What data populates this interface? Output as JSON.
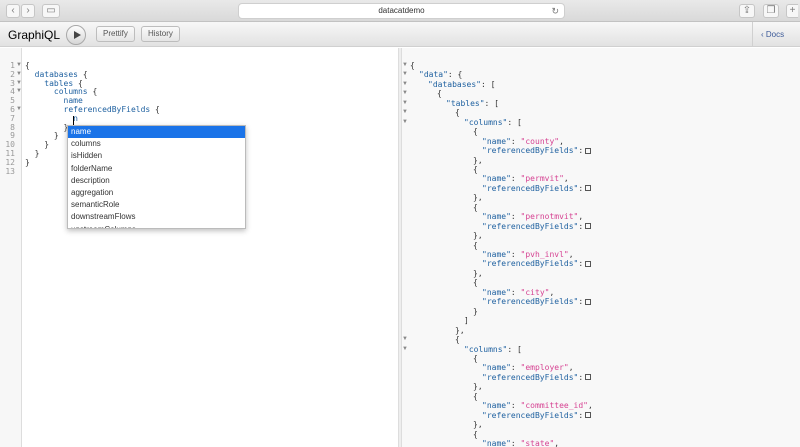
{
  "browser": {
    "url": "datacatdemo",
    "back_glyph": "‹",
    "forward_glyph": "›",
    "sidebar_glyph": "▭",
    "reload_glyph": "↻",
    "share_glyph": "⇪",
    "tabs_glyph": "❐",
    "newtab_glyph": "+"
  },
  "toolbar": {
    "logo": "GraphiQL",
    "prettify_label": "Prettify",
    "history_label": "History",
    "docs_label": "Docs"
  },
  "editor": {
    "lines": [
      "{",
      "  databases {",
      "    tables {",
      "      columns {",
      "        name",
      "        referencedByFields {",
      "          n",
      "        }",
      "      }",
      "    }",
      "  }",
      "}",
      ""
    ],
    "line_numbers": [
      "1",
      "2",
      "3",
      "4",
      "5",
      "6",
      "7",
      "8",
      "9",
      "10",
      "11",
      "12",
      "13"
    ]
  },
  "autocomplete": {
    "items": [
      "name",
      "columns",
      "isHidden",
      "folderName",
      "description",
      "aggregation",
      "semanticRole",
      "downstreamFlows",
      "upstreamColumns"
    ],
    "selected_index": 0
  },
  "result": {
    "lines": [
      {
        "indent": 0,
        "text": "{"
      },
      {
        "indent": 1,
        "key": "\"data\"",
        "text": ": {"
      },
      {
        "indent": 2,
        "key": "\"databases\"",
        "text": ": ["
      },
      {
        "indent": 3,
        "text": "{"
      },
      {
        "indent": 4,
        "key": "\"tables\"",
        "text": ": ["
      },
      {
        "indent": 5,
        "text": "{"
      },
      {
        "indent": 6,
        "key": "\"columns\"",
        "text": ": ["
      },
      {
        "indent": 7,
        "text": "{"
      },
      {
        "indent": 8,
        "key": "\"name\"",
        "str": "\"county\"",
        "text": ","
      },
      {
        "indent": 8,
        "key": "\"referencedByFields\"",
        "text": ":",
        "box": true
      },
      {
        "indent": 7,
        "text": "},"
      },
      {
        "indent": 7,
        "text": "{"
      },
      {
        "indent": 8,
        "key": "\"name\"",
        "str": "\"permvit\"",
        "text": ","
      },
      {
        "indent": 8,
        "key": "\"referencedByFields\"",
        "text": ":",
        "box": true
      },
      {
        "indent": 7,
        "text": "},"
      },
      {
        "indent": 7,
        "text": "{"
      },
      {
        "indent": 8,
        "key": "\"name\"",
        "str": "\"pernotmvit\"",
        "text": ","
      },
      {
        "indent": 8,
        "key": "\"referencedByFields\"",
        "text": ":",
        "box": true
      },
      {
        "indent": 7,
        "text": "},"
      },
      {
        "indent": 7,
        "text": "{"
      },
      {
        "indent": 8,
        "key": "\"name\"",
        "str": "\"pvh_invl\"",
        "text": ","
      },
      {
        "indent": 8,
        "key": "\"referencedByFields\"",
        "text": ":",
        "box": true
      },
      {
        "indent": 7,
        "text": "},"
      },
      {
        "indent": 7,
        "text": "{"
      },
      {
        "indent": 8,
        "key": "\"name\"",
        "str": "\"city\"",
        "text": ","
      },
      {
        "indent": 8,
        "key": "\"referencedByFields\"",
        "text": ":",
        "box": true
      },
      {
        "indent": 7,
        "text": "}"
      },
      {
        "indent": 6,
        "text": "]"
      },
      {
        "indent": 5,
        "text": "},"
      },
      {
        "indent": 5,
        "text": "{"
      },
      {
        "indent": 6,
        "key": "\"columns\"",
        "text": ": ["
      },
      {
        "indent": 7,
        "text": "{"
      },
      {
        "indent": 8,
        "key": "\"name\"",
        "str": "\"employer\"",
        "text": ","
      },
      {
        "indent": 8,
        "key": "\"referencedByFields\"",
        "text": ":",
        "box": true
      },
      {
        "indent": 7,
        "text": "},"
      },
      {
        "indent": 7,
        "text": "{"
      },
      {
        "indent": 8,
        "key": "\"name\"",
        "str": "\"committee_id\"",
        "text": ","
      },
      {
        "indent": 8,
        "key": "\"referencedByFields\"",
        "text": ":",
        "box": true
      },
      {
        "indent": 7,
        "text": "},"
      },
      {
        "indent": 7,
        "text": "{"
      },
      {
        "indent": 8,
        "key": "\"name\"",
        "str": "\"state\"",
        "text": ","
      }
    ]
  }
}
